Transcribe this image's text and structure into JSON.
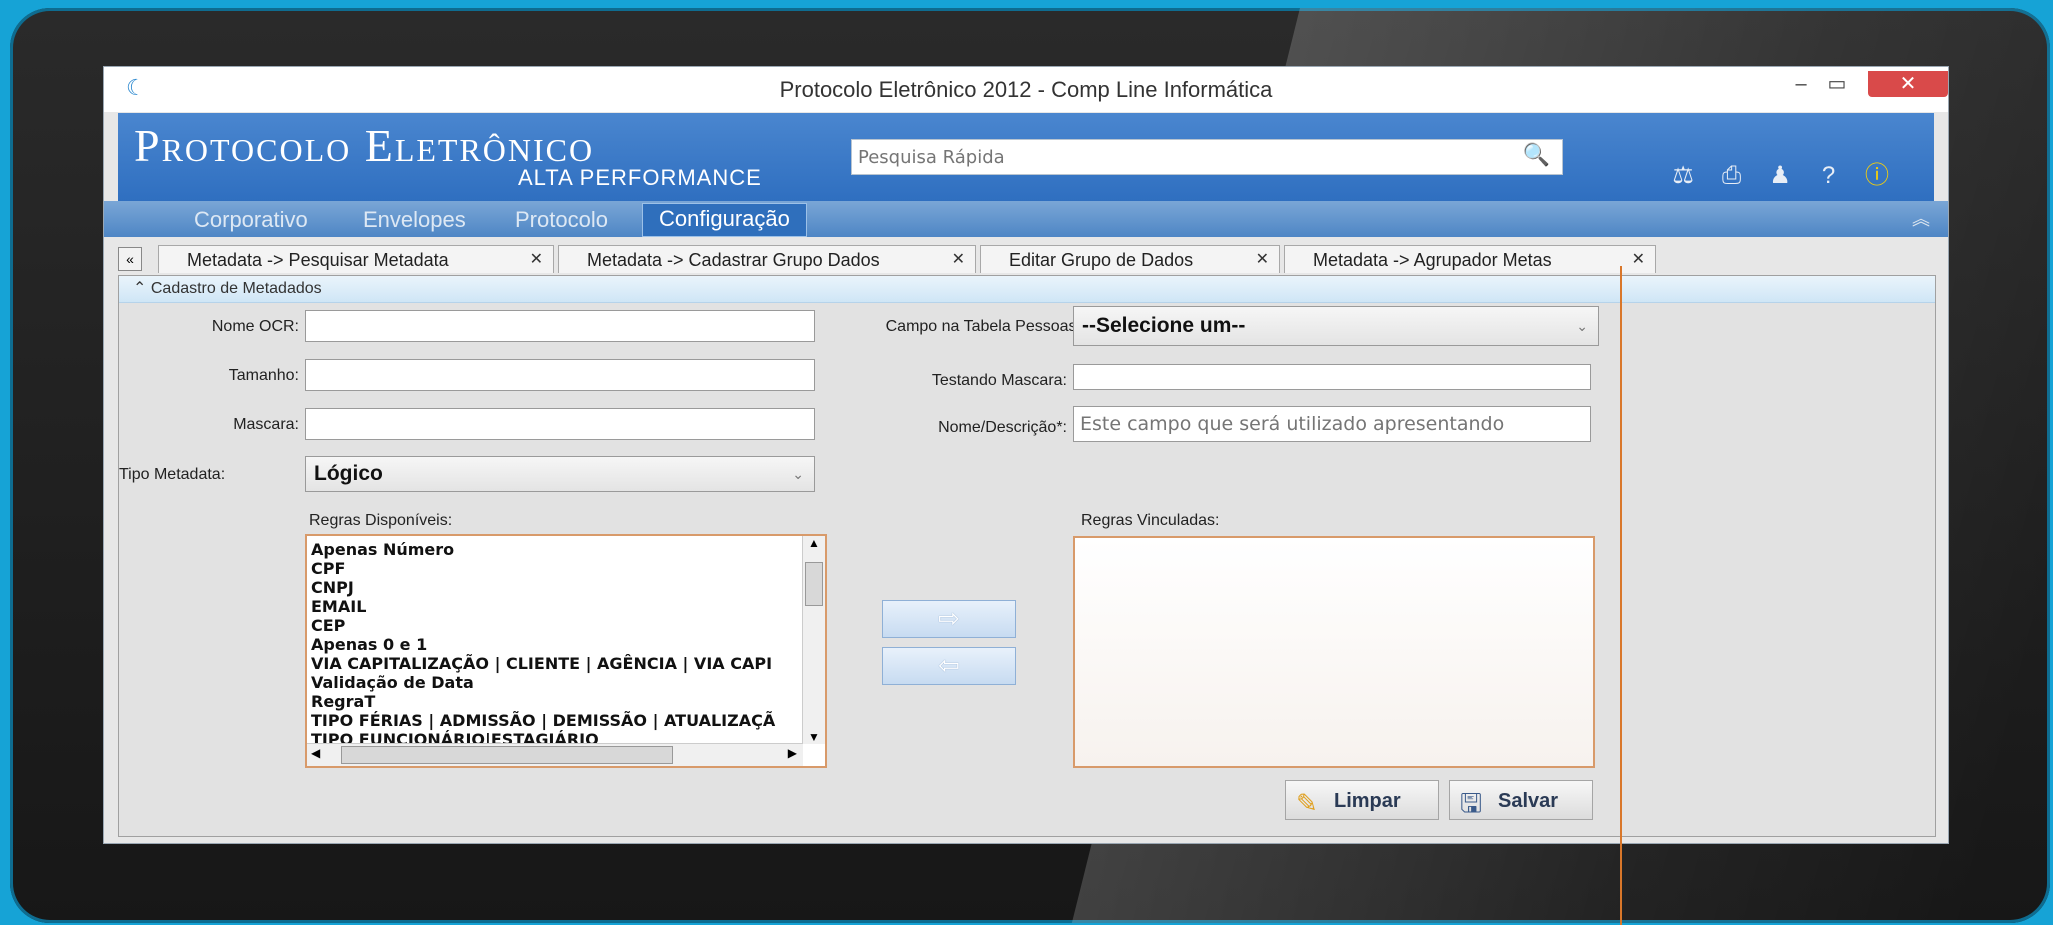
{
  "window": {
    "title": "Protocolo Eletrônico 2012 - Comp Line Informática",
    "min_label": "–",
    "max_label": "▭",
    "close_label": "✕"
  },
  "banner": {
    "logo_main": "Protocolo Eletrônico",
    "logo_sub": "ALTA PERFORMANCE",
    "search_placeholder": "Pesquisa Rápida",
    "tool_icons": [
      "scales-icon",
      "printer-icon",
      "user-icon",
      "help-icon",
      "info-icon"
    ]
  },
  "menu": {
    "items": [
      "Corporativo",
      "Envelopes",
      "Protocolo",
      "Configuração"
    ],
    "active": "Configuração"
  },
  "tabs": [
    {
      "label": "Metadata -> Pesquisar Metadata"
    },
    {
      "label": "Metadata -> Cadastrar Grupo Dados"
    },
    {
      "label": "Editar Grupo de Dados"
    },
    {
      "label": "Metadata -> Agrupador Metas"
    }
  ],
  "form": {
    "section_title": "Cadastro de Metadados",
    "nome_ocr_label": "Nome OCR:",
    "nome_ocr_value": "",
    "tamanho_label": "Tamanho:",
    "tamanho_value": "",
    "mascara_label": "Mascara:",
    "mascara_value": "",
    "tipo_label": "Tipo Metadata:",
    "tipo_value": "Lógico",
    "campo_label": "Campo na Tabela Pessoas:",
    "campo_value": "--Selecione um--",
    "testando_label": "Testando Mascara:",
    "testando_value": "",
    "nome_desc_label": "Nome/Descrição*:",
    "nome_desc_placeholder": "Este campo que será utilizado apresentando",
    "regras_disp_label": "Regras Disponíveis:",
    "regras_vinc_label": "Regras Vinculadas:",
    "regras_disponiveis": [
      "Apenas Número",
      "CPF",
      "CNPJ",
      "EMAIL",
      "CEP",
      "Apenas 0 e 1",
      "VIA CAPITALIZAÇÃO | CLIENTE | AGÊNCIA | VIA CAPI",
      "Validação de Data",
      "RegraT",
      "TIPO FÉRIAS | ADMISSÃO | DEMISSÃO | ATUALIZAÇÃ",
      "TIPO FUNCIONÁRIO|ESTAGIÁRIO"
    ],
    "regras_vinculadas": [],
    "add_arrow": "⇨",
    "remove_arrow": "⇦",
    "limpar_label": "Limpar",
    "salvar_label": "Salvar"
  },
  "colors": {
    "banner": "#3a78c6",
    "listbox_border": "#d89a6a",
    "close_button": "#d94a4a"
  }
}
